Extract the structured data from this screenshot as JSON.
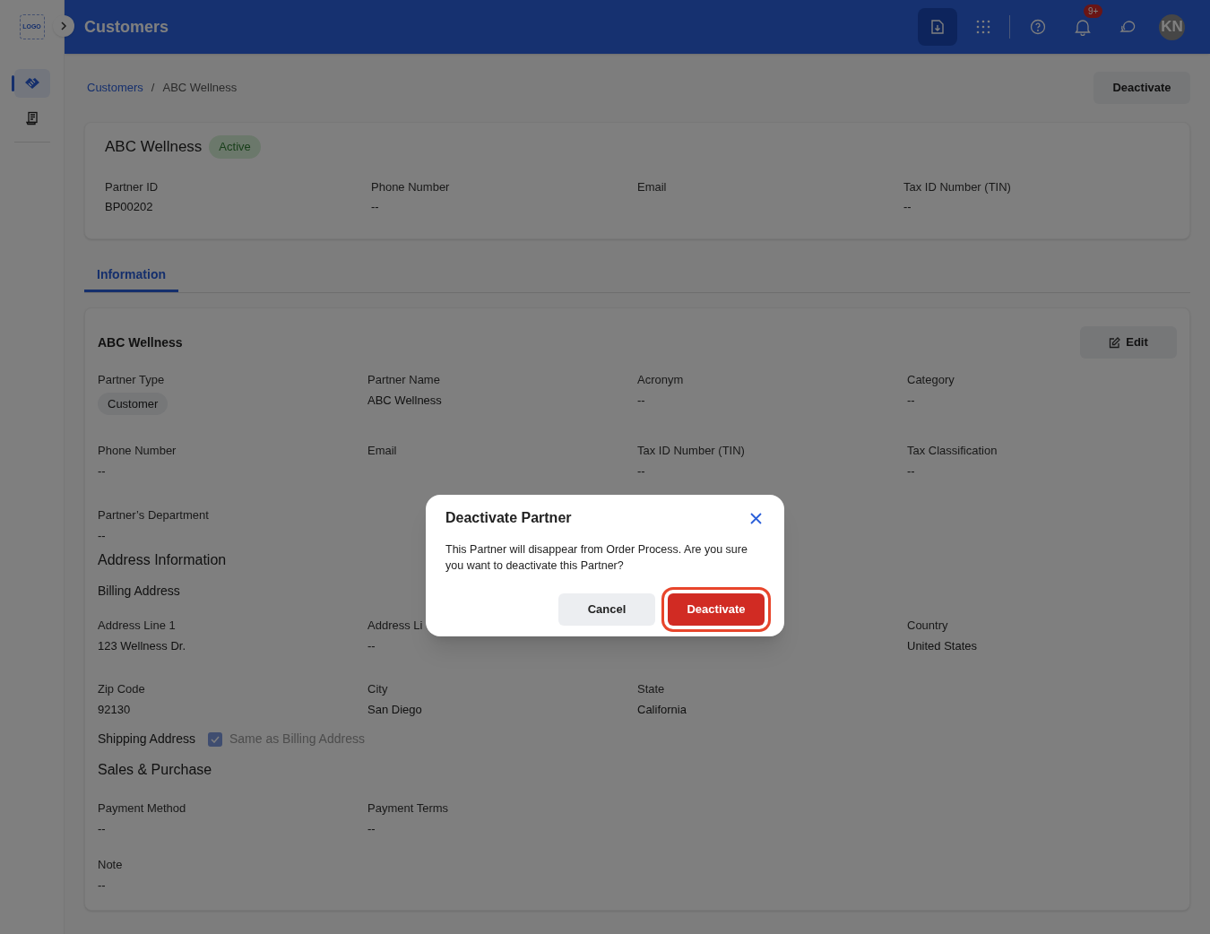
{
  "header": {
    "logo": "LOGO",
    "title": "Customers",
    "notification_count": "9+",
    "avatar": "KN"
  },
  "sidebar": {
    "items": [
      {
        "selected": true
      },
      {
        "selected": false
      }
    ]
  },
  "breadcrumb": {
    "items": [
      "Customers",
      "ABC Wellness"
    ],
    "separator": "/"
  },
  "page_action": "Deactivate",
  "summary": {
    "name": "ABC Wellness",
    "status": "Active",
    "fields": [
      {
        "label": "Partner ID",
        "value": "BP00202"
      },
      {
        "label": "Phone Number",
        "value": "--"
      },
      {
        "label": "Email"
      },
      {
        "label": "Tax ID Number (TIN)",
        "value": "--"
      }
    ]
  },
  "tabs": [
    {
      "label": "Information",
      "selected": true
    }
  ],
  "details": {
    "title": "ABC Wellness",
    "edit_button": "Edit",
    "fields": [
      {
        "label": "Partner Type",
        "value": "Customer",
        "kind": "chip"
      },
      {
        "label": "Partner Name",
        "value": "ABC Wellness",
        "kind": "text"
      },
      {
        "label": "Acronym",
        "value": "--",
        "kind": "text"
      },
      {
        "label": "Category",
        "value": "--",
        "kind": "text"
      },
      {
        "label": "Phone Number",
        "value": "--",
        "kind": "text"
      },
      {
        "label": "Email"
      },
      {
        "label": "Tax ID Number (TIN)",
        "value": "--",
        "kind": "text"
      },
      {
        "label": "Tax Classification",
        "value": "--",
        "kind": "text"
      },
      {
        "label": "Partner’s Department",
        "value": "--",
        "kind": "text"
      }
    ],
    "address_title": "Address Information",
    "billing_title": "Billing Address",
    "billing_fields": [
      {
        "label": "Address Line 1",
        "value": "123 Wellness Dr."
      },
      {
        "label": "Address Li",
        "value": "--"
      },
      {
        "label": "Country",
        "value": "United States"
      },
      {
        "label": "Zip Code",
        "value": "92130"
      },
      {
        "label": "City",
        "value": "San Diego"
      },
      {
        "label": "State",
        "value": "California"
      }
    ],
    "shipping_title": "Shipping Address",
    "shipping_same": {
      "label": "Same as Billing Address",
      "checked": true
    },
    "sales_title": "Sales & Purchase",
    "sales_fields": [
      {
        "label": "Payment Method",
        "value": "--"
      },
      {
        "label": "Payment Terms",
        "value": "--"
      },
      {
        "label": "Note",
        "value": "--"
      }
    ]
  },
  "dialog": {
    "title": "Deactivate Partner",
    "message": "This Partner will disappear from Order Process. Are you sure you want to deactivate this Partner?",
    "buttons": [
      {
        "label": "Cancel",
        "kind": "secondary"
      },
      {
        "label": "Deactivate",
        "kind": "danger"
      }
    ]
  }
}
